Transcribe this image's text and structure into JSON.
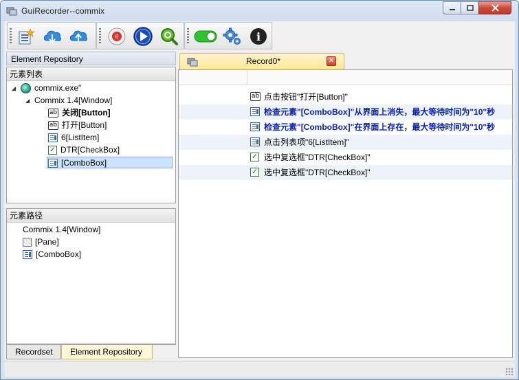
{
  "window": {
    "title": "GuiRecorder--commix"
  },
  "toolbar": {
    "buttons": [
      {
        "name": "new-project-icon"
      },
      {
        "name": "download-icon"
      },
      {
        "name": "upload-icon"
      },
      {
        "name": "record-icon",
        "badge": "6"
      },
      {
        "name": "play-icon"
      },
      {
        "name": "find-icon"
      },
      {
        "name": "toggle-on-icon"
      },
      {
        "name": "settings-gear-icon"
      },
      {
        "name": "info-icon",
        "glyph": "i"
      }
    ]
  },
  "repository": {
    "title": "Element Repository",
    "element_list": {
      "header": "元素列表",
      "items": [
        {
          "label": "commix.exe\"",
          "level": 0,
          "icon": "app",
          "expanded": true
        },
        {
          "label": "Commix 1.4[Window]",
          "level": 1,
          "icon": "none",
          "expanded": true
        },
        {
          "label": "关闭[Button]",
          "level": 2,
          "icon": "ab",
          "bold": true
        },
        {
          "label": "打开[Button]",
          "level": 2,
          "icon": "ab"
        },
        {
          "label": "6[ListItem]",
          "level": 2,
          "icon": "list"
        },
        {
          "label": "DTR[CheckBox]",
          "level": 2,
          "icon": "check"
        },
        {
          "label": "[ComboBox]",
          "level": 2,
          "icon": "list",
          "selected": true
        }
      ]
    },
    "element_path": {
      "header": "元素路径",
      "items": [
        {
          "label": "Commix 1.4[Window]",
          "icon": "none"
        },
        {
          "label": "[Pane]",
          "icon": "pane"
        },
        {
          "label": "[ComboBox]",
          "icon": "list"
        }
      ]
    },
    "bottom_tabs": [
      "Recordset",
      "Element Repository"
    ],
    "icon_glyphs": {
      "ab": "ab",
      "check": "✓",
      "expander": "◢"
    }
  },
  "record": {
    "tab_label": "Record0*",
    "close_glyph": "✕",
    "steps": [
      {
        "icon": "ab",
        "text": "点击按钮\"打开[Button]\"",
        "style": "normal"
      },
      {
        "icon": "list",
        "text": "检查元素\"[ComboBox]\"从界面上消失，最大等待时间为\"10\"秒",
        "style": "check"
      },
      {
        "icon": "list",
        "text": "检查元素\"[ComboBox]\"在界面上存在，最大等待时间为\"10\"秒",
        "style": "check"
      },
      {
        "icon": "list",
        "text": "点击列表项\"6[ListItem]\"",
        "style": "normal"
      },
      {
        "icon": "check",
        "text": "选中复选框\"DTR[CheckBox]\"",
        "style": "normal"
      },
      {
        "icon": "check",
        "text": "选中复选框\"DTR[CheckBox]\"",
        "style": "normal"
      }
    ]
  },
  "colors": {
    "check_text": "#0a1fa8",
    "selection": "#cde2fb",
    "tab_active": "#fff5c9"
  }
}
